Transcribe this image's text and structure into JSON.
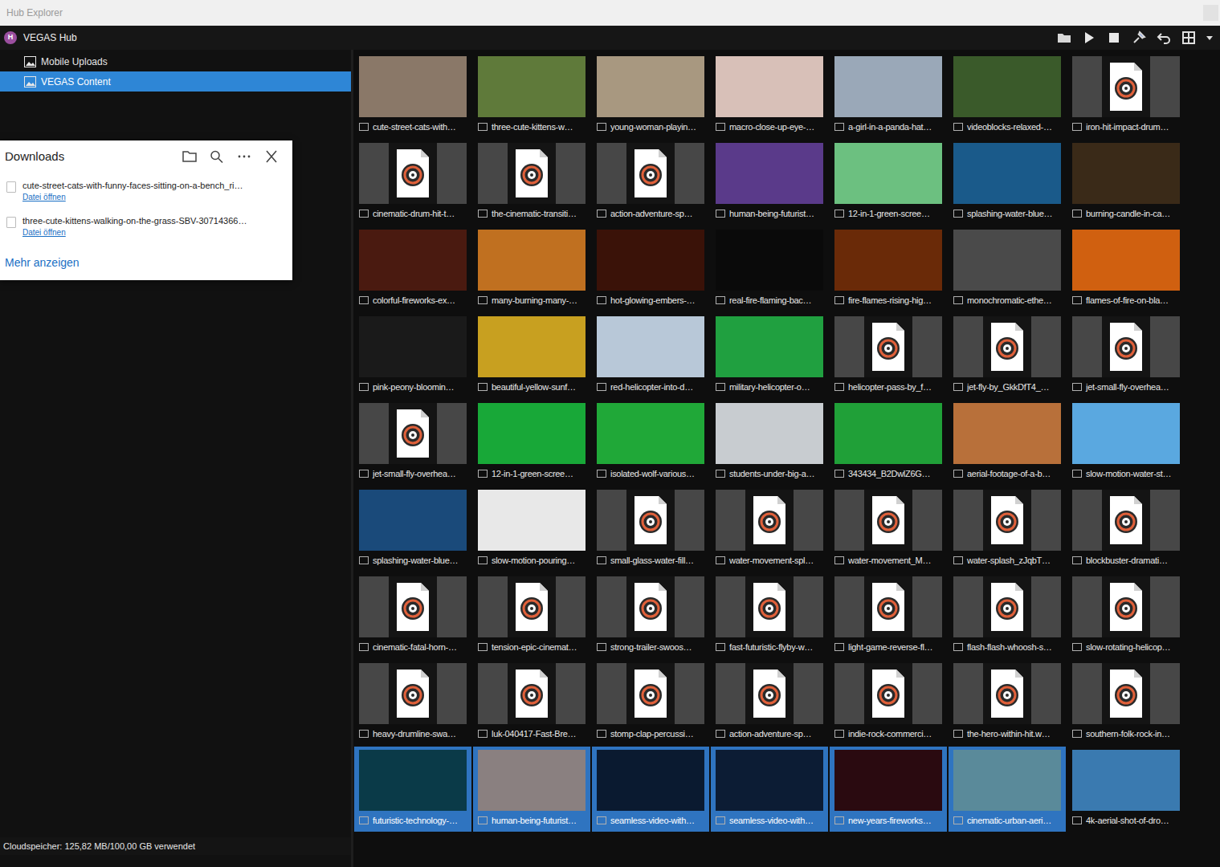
{
  "window": {
    "title": "Hub Explorer"
  },
  "hub": {
    "badge": "H",
    "name": "VEGAS Hub"
  },
  "sidebar": {
    "items": [
      {
        "label": "Mobile Uploads",
        "selected": false
      },
      {
        "label": "VEGAS Content",
        "selected": true
      }
    ]
  },
  "downloads": {
    "title": "Downloads",
    "items": [
      {
        "name": "cute-street-cats-with-funny-faces-sitting-on-a-bench_ri…",
        "action": "Datei öffnen"
      },
      {
        "name": "three-cute-kittens-walking-on-the-grass-SBV-30714366…",
        "action": "Datei öffnen"
      }
    ],
    "more": "Mehr anzeigen"
  },
  "grid": {
    "items": [
      {
        "label": "cute-street-cats-with…",
        "kind": "video",
        "color": "#8a7868",
        "selected": false
      },
      {
        "label": "three-cute-kittens-w…",
        "kind": "video",
        "color": "#5f7a3a",
        "selected": false
      },
      {
        "label": "young-woman-playin…",
        "kind": "video",
        "color": "#a89880",
        "selected": false
      },
      {
        "label": "macro-close-up-eye-…",
        "kind": "video",
        "color": "#d8c0b8",
        "selected": false
      },
      {
        "label": "a-girl-in-a-panda-hat…",
        "kind": "video",
        "color": "#9aa8b8",
        "selected": false
      },
      {
        "label": "videoblocks-relaxed-…",
        "kind": "video",
        "color": "#3a5a2a",
        "selected": false
      },
      {
        "label": "iron-hit-impact-drum…",
        "kind": "audio",
        "selected": false
      },
      {
        "label": "cinematic-drum-hit-t…",
        "kind": "audio",
        "selected": false
      },
      {
        "label": "the-cinematic-transiti…",
        "kind": "audio",
        "selected": false
      },
      {
        "label": "action-adventure-sp…",
        "kind": "audio",
        "selected": false
      },
      {
        "label": "human-being-futurist…",
        "kind": "video",
        "color": "#5a3a8a",
        "selected": false
      },
      {
        "label": "12-in-1-green-scree…",
        "kind": "video",
        "color": "#6cc080",
        "selected": false
      },
      {
        "label": "splashing-water-blue…",
        "kind": "video",
        "color": "#1a5a8a",
        "selected": false
      },
      {
        "label": "burning-candle-in-ca…",
        "kind": "video",
        "color": "#3a2a18",
        "selected": false
      },
      {
        "label": "colorful-fireworks-ex…",
        "kind": "video",
        "color": "#4a1a10",
        "selected": false
      },
      {
        "label": "many-burning-many-…",
        "kind": "video",
        "color": "#c07020",
        "selected": false
      },
      {
        "label": "hot-glowing-embers-…",
        "kind": "video",
        "color": "#3a1208",
        "selected": false
      },
      {
        "label": "real-fire-flaming-bac…",
        "kind": "video",
        "color": "#0a0a0a",
        "selected": false
      },
      {
        "label": "fire-flames-rising-hig…",
        "kind": "video",
        "color": "#6a2a08",
        "selected": false
      },
      {
        "label": "monochromatic-ethe…",
        "kind": "video",
        "color": "#4a4a4a",
        "selected": false
      },
      {
        "label": "flames-of-fire-on-bla…",
        "kind": "video",
        "color": "#d06010",
        "selected": false
      },
      {
        "label": "pink-peony-bloomin…",
        "kind": "video",
        "color": "#1a1a1a",
        "selected": false
      },
      {
        "label": "beautiful-yellow-sunf…",
        "kind": "video",
        "color": "#c8a020",
        "selected": false
      },
      {
        "label": "red-helicopter-into-d…",
        "kind": "video",
        "color": "#b8c8d8",
        "selected": false
      },
      {
        "label": "military-helicopter-o…",
        "kind": "video",
        "color": "#20a040",
        "selected": false
      },
      {
        "label": "helicopter-pass-by_f…",
        "kind": "audio",
        "selected": false
      },
      {
        "label": "jet-fly-by_GkkDfT4_…",
        "kind": "audio",
        "selected": false
      },
      {
        "label": "jet-small-fly-overhea…",
        "kind": "audio",
        "selected": false
      },
      {
        "label": "jet-small-fly-overhea…",
        "kind": "audio",
        "selected": false
      },
      {
        "label": "12-in-1-green-scree…",
        "kind": "video",
        "color": "#18a838",
        "selected": false
      },
      {
        "label": "isolated-wolf-various…",
        "kind": "video",
        "color": "#20a838",
        "selected": false
      },
      {
        "label": "students-under-big-a…",
        "kind": "video",
        "color": "#c8ccd0",
        "selected": false
      },
      {
        "label": "343434_B2DwlZ6G…",
        "kind": "video",
        "color": "#20a038",
        "selected": false
      },
      {
        "label": "aerial-footage-of-a-b…",
        "kind": "video",
        "color": "#b8703a",
        "selected": false
      },
      {
        "label": "slow-motion-water-st…",
        "kind": "video",
        "color": "#5aa8e0",
        "selected": false
      },
      {
        "label": "splashing-water-blue…",
        "kind": "video",
        "color": "#1a4a7a",
        "selected": false
      },
      {
        "label": "slow-motion-pouring…",
        "kind": "video",
        "color": "#e8e8e8",
        "selected": false
      },
      {
        "label": "small-glass-water-fill…",
        "kind": "audio",
        "selected": false
      },
      {
        "label": "water-movement-spl…",
        "kind": "audio",
        "selected": false
      },
      {
        "label": "water-movement_M…",
        "kind": "audio",
        "selected": false
      },
      {
        "label": "water-splash_zJqbT…",
        "kind": "audio",
        "selected": false
      },
      {
        "label": "blockbuster-dramati…",
        "kind": "audio",
        "selected": false
      },
      {
        "label": "cinematic-fatal-horn-…",
        "kind": "audio",
        "selected": false
      },
      {
        "label": "tension-epic-cinemat…",
        "kind": "audio",
        "selected": false
      },
      {
        "label": "strong-trailer-swoos…",
        "kind": "audio",
        "selected": false
      },
      {
        "label": "fast-futuristic-flyby-w…",
        "kind": "audio",
        "selected": false
      },
      {
        "label": "light-game-reverse-fl…",
        "kind": "audio",
        "selected": false
      },
      {
        "label": "flash-flash-whoosh-s…",
        "kind": "audio",
        "selected": false
      },
      {
        "label": "slow-rotating-helicop…",
        "kind": "audio",
        "selected": false
      },
      {
        "label": "heavy-drumline-swa…",
        "kind": "audio",
        "selected": false
      },
      {
        "label": "luk-040417-Fast-Bre…",
        "kind": "audio",
        "selected": false
      },
      {
        "label": "stomp-clap-percussi…",
        "kind": "audio",
        "selected": false
      },
      {
        "label": "action-adventure-sp…",
        "kind": "audio",
        "selected": false
      },
      {
        "label": "indie-rock-commerci…",
        "kind": "audio",
        "selected": false
      },
      {
        "label": "the-hero-within-hit.w…",
        "kind": "audio",
        "selected": false
      },
      {
        "label": "southern-folk-rock-in…",
        "kind": "audio",
        "selected": false
      },
      {
        "label": "futuristic-technology-…",
        "kind": "video",
        "color": "#0a3a48",
        "selected": true
      },
      {
        "label": "human-being-futurist…",
        "kind": "video",
        "color": "#8a8080",
        "selected": true
      },
      {
        "label": "seamless-video-with…",
        "kind": "video",
        "color": "#0a1a30",
        "selected": true
      },
      {
        "label": "seamless-video-with…",
        "kind": "video",
        "color": "#0c1c34",
        "selected": true
      },
      {
        "label": "new-years-fireworks…",
        "kind": "video",
        "color": "#2a0a10",
        "selected": true
      },
      {
        "label": "cinematic-urban-aeri…",
        "kind": "video",
        "color": "#5a8a9a",
        "selected": true
      },
      {
        "label": "4k-aerial-shot-of-dro…",
        "kind": "video",
        "color": "#3a7ab0",
        "selected": false
      }
    ]
  },
  "status_bar": "Cloudspeicher: 125,82 MB/100,00 GB verwendet"
}
